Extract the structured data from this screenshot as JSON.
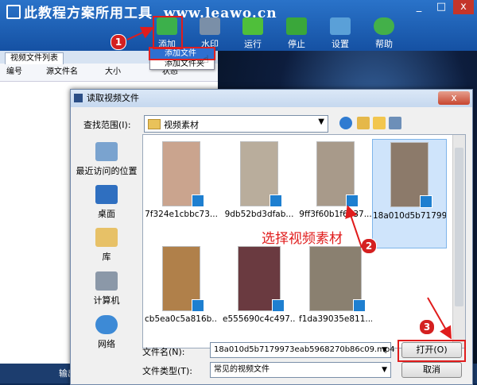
{
  "app": {
    "title": "此教程方案所用工具",
    "url": "www.leawo.cn",
    "window_controls": [
      "_",
      "□",
      "x"
    ],
    "toolbar": [
      {
        "label": "添加",
        "color": "#3cb04b"
      },
      {
        "label": "水印",
        "color": "#7a8fa8"
      },
      {
        "label": "运行",
        "color": "#4fbf3a"
      },
      {
        "label": "停止",
        "color": "#3aa73a"
      },
      {
        "label": "设置",
        "color": "#5aa0d8"
      },
      {
        "label": "帮助",
        "color": "#43b049"
      }
    ],
    "add_menu": [
      "添加文件",
      "添加文件夹"
    ],
    "file_list": {
      "tab": "视频文件列表",
      "columns": [
        "编号",
        "源文件名",
        "大小",
        "状态"
      ]
    },
    "status_text": "输出"
  },
  "dialog": {
    "title": "读取视频文件",
    "close": "x",
    "look_in_label": "查找范围(I):",
    "look_in_value": "视频素材",
    "places": [
      {
        "label": "最近访问的位置",
        "icon": "recent-places-icon"
      },
      {
        "label": "桌面",
        "icon": "desktop-icon"
      },
      {
        "label": "库",
        "icon": "library-icon"
      },
      {
        "label": "计算机",
        "icon": "computer-icon"
      },
      {
        "label": "网络",
        "icon": "network-icon"
      }
    ],
    "files": [
      {
        "name": "7f324e1cbbc73...",
        "color": "#caa48e"
      },
      {
        "name": "9db52bd3dfab...",
        "color": "#b9ad9c"
      },
      {
        "name": "9ff3f60b1f6737...",
        "color": "#a89a8a"
      },
      {
        "name": "18a010d5b7179973eab5968270b86c09.mp4",
        "color": "#8c7a6a"
      },
      {
        "name": "cb5ea0c5a816b...",
        "color": "#b0804a"
      },
      {
        "name": "e555690c4c497...",
        "color": "#6a3a40"
      },
      {
        "name": "f1da39035e811...",
        "color": "#8a8070"
      }
    ],
    "filename_label": "文件名(N):",
    "filename_value": "18a010d5b7179973eab5968270b86c09.mp4",
    "filetype_label": "文件类型(T):",
    "filetype_value": "常见的视频文件",
    "open_button": "打开(O)",
    "cancel_button": "取消"
  },
  "annotations": {
    "step1": "1",
    "step2": "2",
    "step3": "3",
    "text": "选择视频素材"
  }
}
